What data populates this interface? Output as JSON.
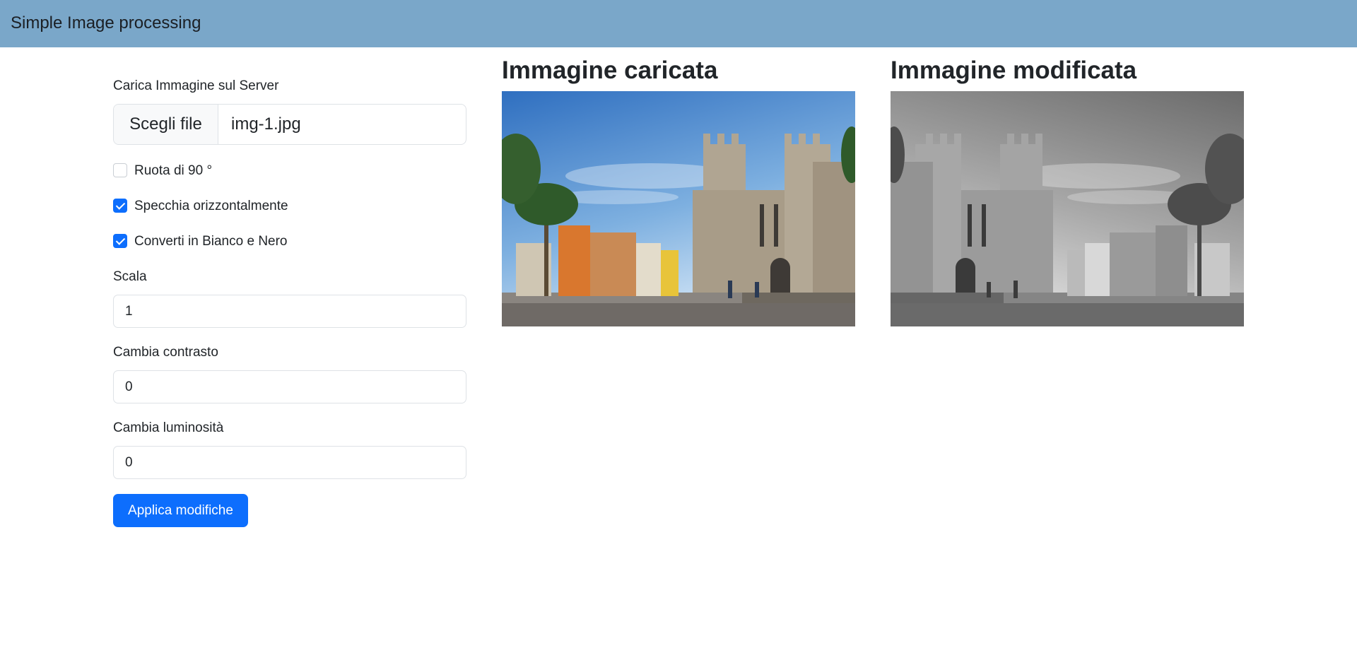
{
  "navbar": {
    "brand": "Simple Image processing"
  },
  "form": {
    "upload_label": "Carica Immagine sul Server",
    "file_button_label": "Scegli file",
    "file_name": "img-1.jpg",
    "options": [
      {
        "label": "Ruota di 90 °",
        "checked": false
      },
      {
        "label": "Specchia orizzontalmente",
        "checked": true
      },
      {
        "label": "Converti in Bianco e Nero",
        "checked": true
      }
    ],
    "scale": {
      "label": "Scala",
      "value": "1"
    },
    "contrast": {
      "label": "Cambia contrasto",
      "value": "0"
    },
    "brightness": {
      "label": "Cambia luminosità",
      "value": "0"
    },
    "apply_label": "Applica modifiche"
  },
  "images": {
    "original_title": "Immagine caricata",
    "modified_title": "Immagine modificata"
  },
  "colors": {
    "navbar_bg": "#7aa7c9",
    "primary": "#0d6efd"
  }
}
